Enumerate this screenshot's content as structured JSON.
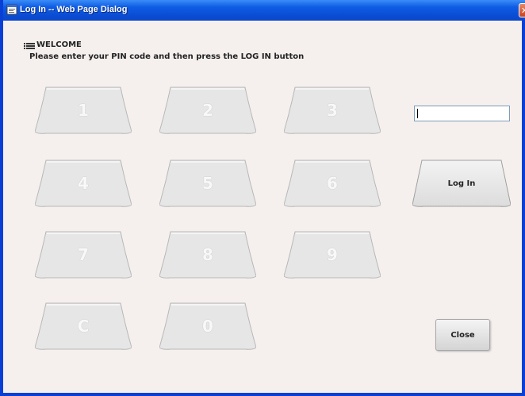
{
  "window": {
    "title": "Log In -- Web Page Dialog",
    "title_icon": "web-page-dialog-icon",
    "close_icon": "close-icon"
  },
  "header": {
    "icon": "list-icon",
    "welcome": "WELCOME",
    "instructions": "Please enter your PIN code and then press the LOG IN button"
  },
  "keypad": {
    "keys": [
      "1",
      "2",
      "3",
      "4",
      "5",
      "6",
      "7",
      "8",
      "9",
      "C",
      "0"
    ]
  },
  "pin": {
    "value": ""
  },
  "actions": {
    "login_label": "Log In",
    "close_label": "Close"
  },
  "colors": {
    "titlebar": "#0a4fd6",
    "window_bg": "#f5f0ee",
    "key_face": "#e6e6e6",
    "key_label": "#f8f8f8"
  }
}
